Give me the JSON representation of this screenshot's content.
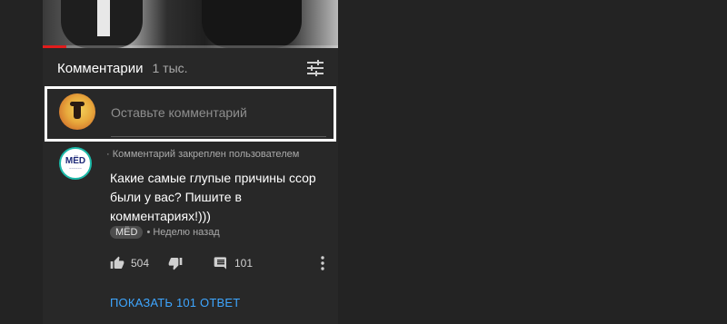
{
  "video": {
    "progress": 0.08
  },
  "comments_header": {
    "title": "Комментарии",
    "count": "1 тыс."
  },
  "add_comment": {
    "placeholder": "Оставьте комментарий"
  },
  "pinned_comment": {
    "pinned_label": "Комментарий закреплен пользователем",
    "avatar_logo": "MЁD",
    "text": "Какие самые глупые причины ссор были у вас? Пишите в комментариях!)))",
    "author": "MЁD",
    "time": "• Неделю назад",
    "likes": "504",
    "replies_count": "101",
    "show_replies": "ПОКАЗАТЬ 101 ОТВЕТ"
  },
  "icons": {
    "sort": "sort-filter-icon",
    "like": "thumb-up-icon",
    "dislike": "thumb-down-icon",
    "reply": "comment-icon",
    "more": "more-vert-icon"
  },
  "colors": {
    "background": "#232323",
    "panel": "#282828",
    "link": "#3ea6ff",
    "progress": "#e21c1c",
    "avatar_ring": "#1bb9a8"
  }
}
